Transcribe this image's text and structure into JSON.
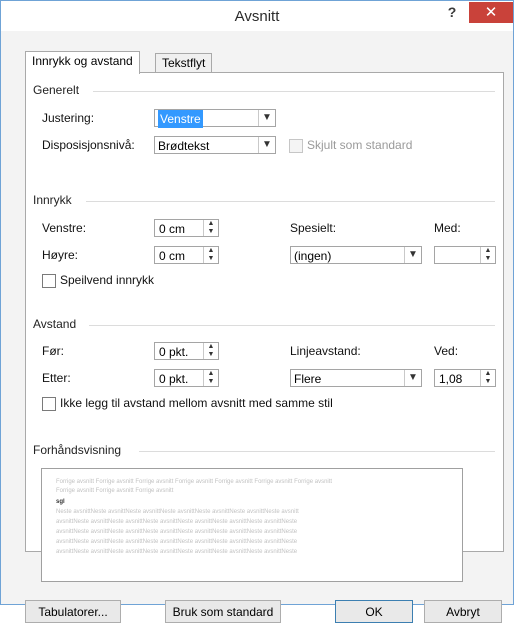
{
  "window": {
    "title": "Avsnitt",
    "help": "?",
    "close": "✕"
  },
  "tabs": [
    {
      "label": "Innrykk og avstand",
      "active": true
    },
    {
      "label": "Tekstflyt",
      "active": false
    }
  ],
  "generelt": {
    "heading": "Generelt",
    "justering_label": "Justering:",
    "justering_value": "Venstre",
    "disposisjon_label": "Disposisjonsnivå:",
    "disposisjon_value": "Brødtekst",
    "skjult_label": "Skjult som standard"
  },
  "innrykk": {
    "heading": "Innrykk",
    "venstre_label": "Venstre:",
    "venstre_value": "0 cm",
    "hoyre_label": "Høyre:",
    "hoyre_value": "0 cm",
    "spesielt_label": "Spesielt:",
    "spesielt_value": "(ingen)",
    "med_label": "Med:",
    "med_value": "",
    "speilvend_label": "Speilvend innrykk"
  },
  "avstand": {
    "heading": "Avstand",
    "for_label": "Før:",
    "for_value": "0 pkt.",
    "etter_label": "Etter:",
    "etter_value": "0 pkt.",
    "linjeavstand_label": "Linjeavstand:",
    "linjeavstand_value": "Flere",
    "ved_label": "Ved:",
    "ved_value": "1,08",
    "ikke_legg_label": "Ikke legg til avstand mellom avsnitt med samme stil"
  },
  "preview": {
    "heading": "Forhåndsvisning",
    "prev_line1": "Forrige avsnitt Forrige avsnitt Forrige avsnitt Forrige avsnitt Forrige avsnitt Forrige avsnitt Forrige avsnitt",
    "prev_line2": "Forrige avsnitt Forrige avsnitt Forrige avsnitt",
    "sample": "sgl",
    "next_lines": [
      "Neste avsnittNeste avsnittNeste avsnittNeste avsnittNeste avsnittNeste avsnittNeste avsnitt",
      "avsnittNeste avsnittNeste avsnittNeste avsnittNeste avsnittNeste avsnittNeste avsnittNeste",
      "avsnittNeste avsnittNeste avsnittNeste avsnittNeste avsnittNeste avsnittNeste avsnittNeste",
      "avsnittNeste avsnittNeste avsnittNeste avsnittNeste avsnittNeste avsnittNeste avsnittNeste",
      "avsnittNeste avsnittNeste avsnittNeste avsnittNeste avsnittNeste avsnittNeste avsnittNeste"
    ]
  },
  "buttons": {
    "tabulatorer": "Tabulatorer...",
    "bruk_som_standard": "Bruk som standard",
    "ok": "OK",
    "avbryt": "Avbryt"
  },
  "colors": {
    "close_red": "#c9423a",
    "selection_blue": "#3399ff",
    "border_blue": "#6fa3d6"
  }
}
